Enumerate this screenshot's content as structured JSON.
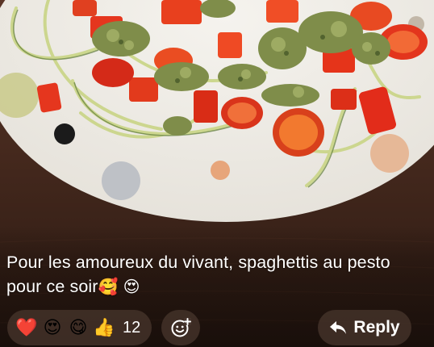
{
  "post": {
    "caption_text": "Pour les amoureux du vivant, spaghettis au pesto pour ce soir",
    "caption_emojis": [
      "🥰",
      "😍"
    ]
  },
  "reactions": {
    "emojis": [
      "❤️",
      "😍",
      "😋",
      "👍"
    ],
    "count": "12"
  },
  "actions": {
    "add_reaction_icon": "smiley-plus-icon",
    "reply_icon": "reply-arrow-icon",
    "reply_label": "Reply"
  },
  "colors": {
    "accent_reaction_bg": "#46342c",
    "text": "#ffffff"
  }
}
